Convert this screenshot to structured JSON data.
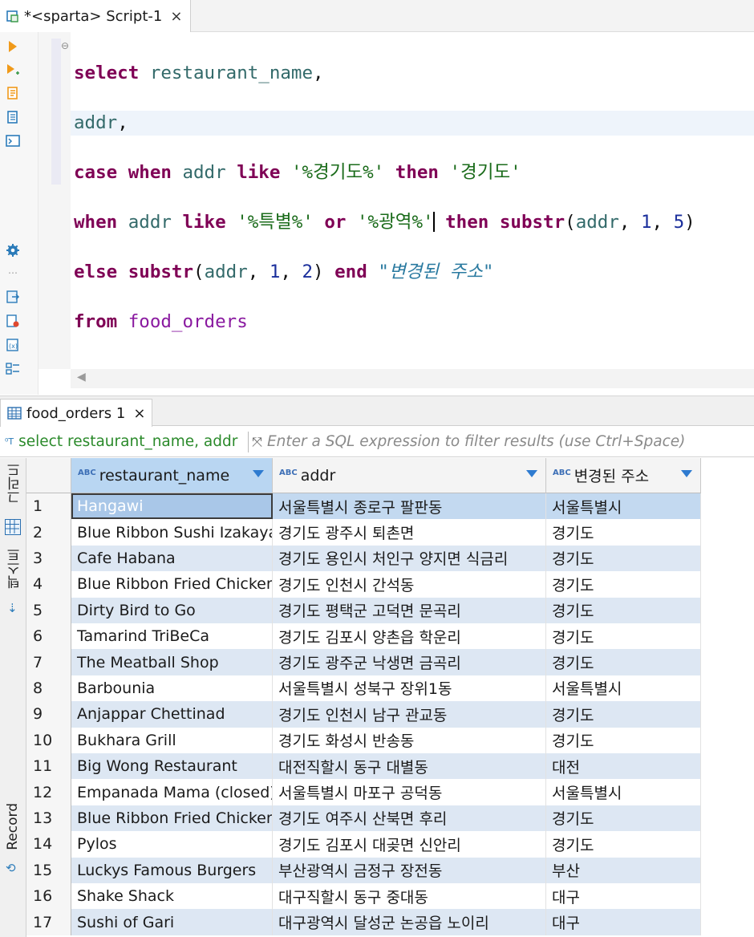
{
  "editor_tab": {
    "title": "*<sparta> Script-1",
    "close": "×"
  },
  "sql": {
    "line1": {
      "kw": "select",
      "col": "restaurant_name",
      "punc": ","
    },
    "line2": {
      "col": "addr",
      "punc": ","
    },
    "line3": {
      "kw1": "case",
      "kw2": "when",
      "col": "addr",
      "kw3": "like",
      "s1": "'%경기도%'",
      "kw4": "then",
      "s2": "'경기도'"
    },
    "line4": {
      "kw1": "when",
      "col": "addr",
      "kw2": "like",
      "s1": "'%특별%'",
      "kw3": "or",
      "s2": "'%광역%'",
      "kw4": "then",
      "fn": "substr",
      "open": "(",
      "col2": "addr",
      "c1": ",",
      "n1": "1",
      "c2": ",",
      "n2": "5",
      "close": ")"
    },
    "line5": {
      "kw1": "else",
      "fn": "substr",
      "open": "(",
      "col": "addr",
      "c1": ",",
      "n1": "1",
      "c2": ",",
      "n2": "2",
      "close": ")",
      "kw2": "end",
      "alias": "\"변경된 주소\""
    },
    "line6": {
      "kw": "from",
      "tbl": "food_orders"
    }
  },
  "results_tab": {
    "title": "food_orders 1",
    "close": "×"
  },
  "filter": {
    "query": "select restaurant_name, addr",
    "placeholder": "Enter a SQL expression to filter results (use Ctrl+Space)"
  },
  "side_tabs": {
    "grid": "그리드",
    "text": "텍스트",
    "record": "Record"
  },
  "columns": [
    {
      "name": "restaurant_name",
      "type": "ABC"
    },
    {
      "name": "addr",
      "type": "ABC"
    },
    {
      "name": "변경된 주소",
      "type": "ABC"
    }
  ],
  "rows": [
    {
      "n": "1",
      "name": "Hangawi",
      "addr": "서울특별시 종로구 팔판동",
      "changed": "서울특별시"
    },
    {
      "n": "2",
      "name": "Blue Ribbon Sushi Izakaya",
      "addr": "경기도 광주시 퇴촌면",
      "changed": "경기도"
    },
    {
      "n": "3",
      "name": "Cafe Habana",
      "addr": "경기도 용인시 처인구 양지면 식금리",
      "changed": "경기도"
    },
    {
      "n": "4",
      "name": "Blue Ribbon Fried Chicken",
      "addr": "경기도 인천시 간석동",
      "changed": "경기도"
    },
    {
      "n": "5",
      "name": "Dirty Bird to Go",
      "addr": "경기도 평택군 고덕면 문곡리",
      "changed": "경기도"
    },
    {
      "n": "6",
      "name": "Tamarind TriBeCa",
      "addr": "경기도 김포시 양촌읍 학운리",
      "changed": "경기도"
    },
    {
      "n": "7",
      "name": "The Meatball Shop",
      "addr": "경기도 광주군 낙생면 금곡리",
      "changed": "경기도"
    },
    {
      "n": "8",
      "name": "Barbounia",
      "addr": "서울특별시 성북구 장위1동",
      "changed": "서울특별시"
    },
    {
      "n": "9",
      "name": "Anjappar Chettinad",
      "addr": "경기도 인천시 남구 관교동",
      "changed": "경기도"
    },
    {
      "n": "10",
      "name": "Bukhara Grill",
      "addr": "경기도 화성시 반송동",
      "changed": "경기도"
    },
    {
      "n": "11",
      "name": "Big Wong Restaurant",
      "addr": "대전직할시 동구 대별동",
      "changed": "대전"
    },
    {
      "n": "12",
      "name": "Empanada Mama (closed)",
      "addr": "서울특별시 마포구 공덕동",
      "changed": "서울특별시"
    },
    {
      "n": "13",
      "name": "Blue Ribbon Fried Chicken",
      "addr": "경기도 여주시 산북면 후리",
      "changed": "경기도"
    },
    {
      "n": "14",
      "name": "Pylos",
      "addr": "경기도 김포시 대곶면 신안리",
      "changed": "경기도"
    },
    {
      "n": "15",
      "name": "Luckys Famous Burgers",
      "addr": "부산광역시 금정구 장전동",
      "changed": "부산"
    },
    {
      "n": "16",
      "name": "Shake Shack",
      "addr": "대구직할시 동구 중대동",
      "changed": "대구"
    },
    {
      "n": "17",
      "name": "Sushi of Gari",
      "addr": "대구광역시 달성군 논공읍 노이리",
      "changed": "대구"
    }
  ],
  "colors": {
    "keyword": "#7f0055",
    "string": "#1a6b1a",
    "selection": "#b9d6f2",
    "alt_row": "#dde7f3"
  }
}
